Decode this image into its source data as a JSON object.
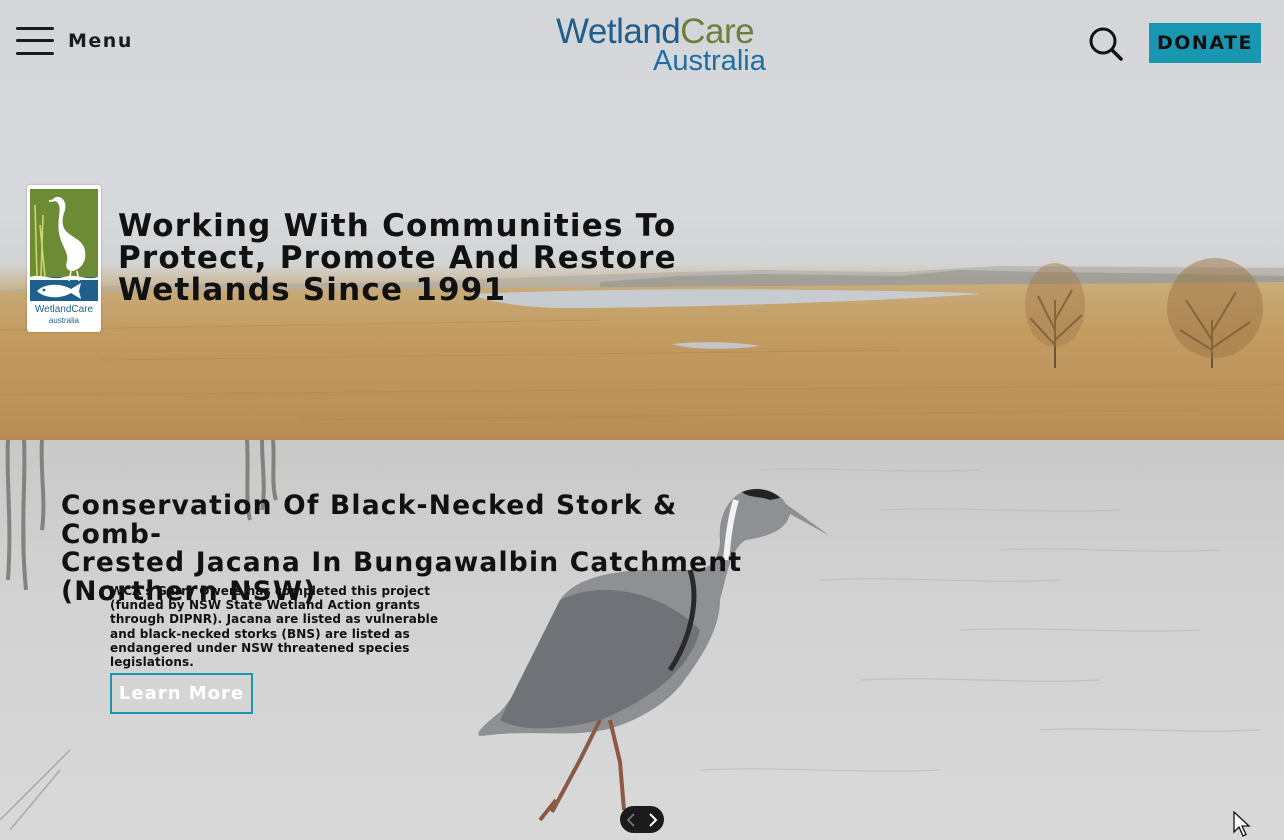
{
  "header": {
    "menu_label": "Menu",
    "logo": {
      "word1": "Wetland",
      "word2": "Care",
      "line2": "Australia"
    },
    "donate_label": "DONATE",
    "colors": {
      "brand_blue": "#1f5f8c",
      "brand_green": "#6d7f3c",
      "accent_teal": "#1a97b0"
    }
  },
  "hero": {
    "badge": {
      "line1": "WetlandCare",
      "line2": "australia"
    },
    "headline_lines": [
      "Working With Communities To",
      "Protect, Promote And Restore",
      "Wetlands Since 1991"
    ]
  },
  "slide": {
    "title_lines": [
      "Conservation Of Black-Necked Stork & Comb-",
      "Crested Jacana In Bungawalbin Catchment",
      "(Northern NSW)"
    ],
    "description_lines": [
      "WCA's Garry Owers has completed this project",
      "(funded by NSW State Wetland Action grants",
      "through DIPNR). Jacana are listed as vulnerable",
      "and black-necked storks (BNS) are listed as",
      "endangered under NSW threatened species",
      "legislations."
    ],
    "cta_label": "Learn More"
  },
  "icons": {
    "menu": "hamburger-icon",
    "search": "search-icon",
    "prev": "chevron-left-icon",
    "next": "chevron-right-icon",
    "cursor": "mouse-pointer-icon"
  }
}
